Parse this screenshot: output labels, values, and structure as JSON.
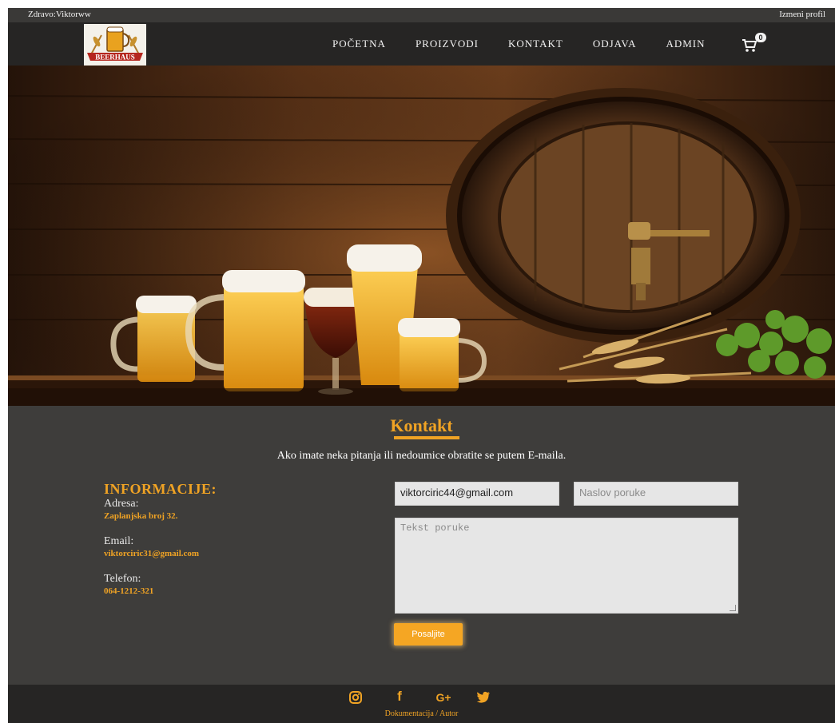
{
  "topbar": {
    "greeting": "Zdravo:Viktorww",
    "edit_profile": "Izmeni profil"
  },
  "nav": {
    "logo_text": "BEERHAUS",
    "items": [
      {
        "label": "POČETNA"
      },
      {
        "label": "PROIZVODI"
      },
      {
        "label": "KONTAKT"
      },
      {
        "label": "ODJAVA"
      },
      {
        "label": "ADMIN"
      }
    ],
    "cart_icon": "shopping-cart-icon",
    "cart_count": "0"
  },
  "contact": {
    "title": "Kontakt",
    "intro": "Ako imate neka pitanja ili nedoumice obratite se putem E-maila.",
    "info": {
      "heading": "INFORMACIJE:",
      "address_label": "Adresa:",
      "address_value": "Zaplanjska broj 32.",
      "email_label": "Email:",
      "email_value": "viktorciric31@gmail.com",
      "phone_label": "Telefon:",
      "phone_value": "064-1212-321"
    },
    "form": {
      "email_value": "viktorciric44@gmail.com",
      "subject_placeholder": "Naslov poruke",
      "message_placeholder": "Tekst poruke",
      "submit_label": "Posaljite"
    }
  },
  "footer": {
    "social": [
      {
        "icon": "instagram-icon"
      },
      {
        "icon": "facebook-icon",
        "glyph": "f"
      },
      {
        "icon": "google-plus-icon",
        "glyph": "G+"
      },
      {
        "icon": "twitter-icon"
      }
    ],
    "links": "Dokumentacija / Autor"
  },
  "colors": {
    "accent": "#f0a324",
    "nav_bg": "#262524",
    "page_bg": "#3e3d3b"
  }
}
